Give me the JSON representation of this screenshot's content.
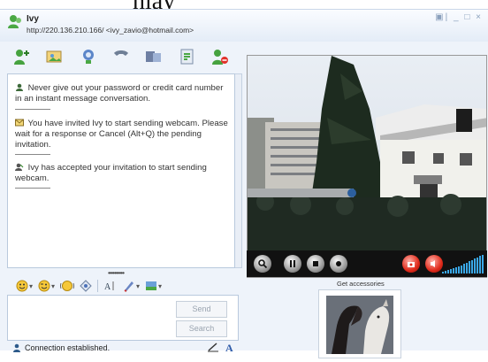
{
  "header_text": "nlay",
  "contact": {
    "name": "Ivy",
    "subtitle": "http://220.136.210.166/ <ivy_zavio@hotmail.com>"
  },
  "window_controls": [
    "▣",
    "_",
    "□",
    "×"
  ],
  "toolbar": {
    "buttons": [
      "invite-contact",
      "send-file",
      "webcam",
      "voice-call",
      "activities",
      "games",
      "block-contact"
    ]
  },
  "conversation": {
    "messages": [
      {
        "icon": "contact-icon",
        "text": "Never give out your password or credit card number in an instant message conversation."
      },
      {
        "icon": "envelope-icon",
        "text": "You have invited Ivy to start sending webcam. Please wait for a response or Cancel (Alt+Q) the pending invitation."
      },
      {
        "icon": "accepted-icon",
        "text": "Ivy has accepted your invitation to start sending webcam."
      }
    ]
  },
  "grip": "••••••••••",
  "compose": {
    "send_label": "Send",
    "search_label": "Search"
  },
  "status": {
    "text": "Connection established."
  },
  "webcam": {
    "controls": [
      "search",
      "pause",
      "stop",
      "record",
      "snapshot",
      "volume"
    ],
    "volume_level": 0.85
  },
  "accessories": {
    "label": "Get accessories"
  },
  "colors": {
    "window_bg": "#eef3fa",
    "accent_blue": "#3aa8e8",
    "button_red": "#e02a1a"
  }
}
